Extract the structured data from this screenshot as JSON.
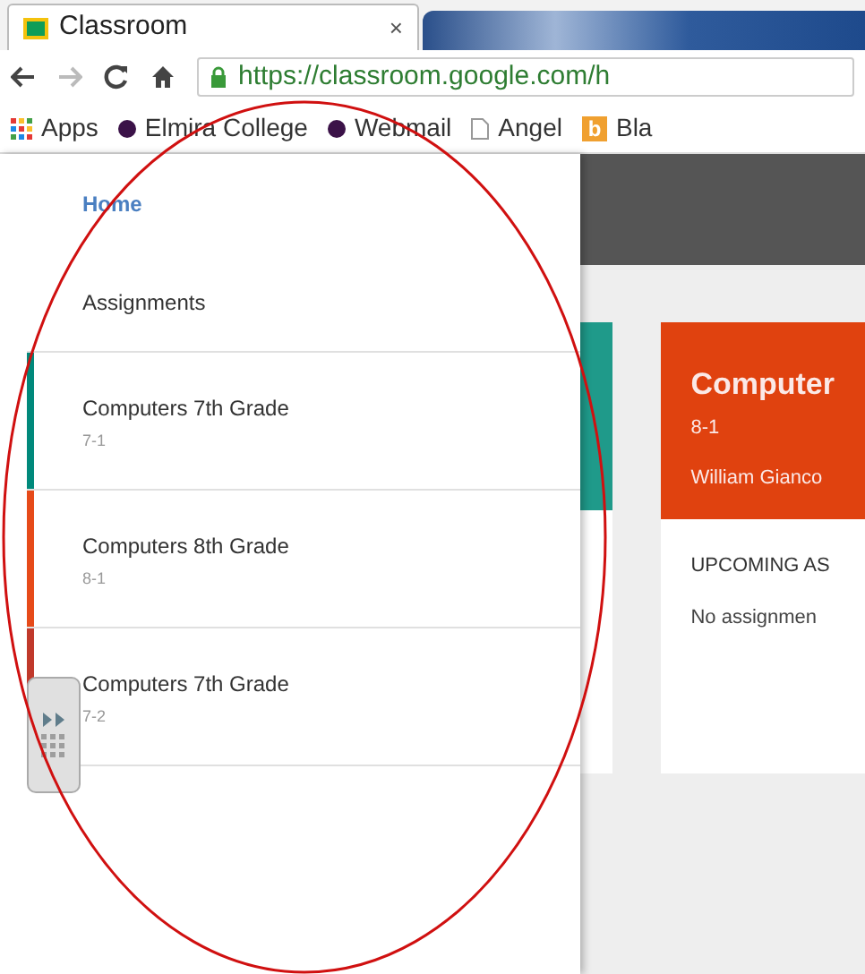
{
  "browser": {
    "tabs": [
      {
        "title": "Classroom",
        "close": "×",
        "selected": true
      },
      {
        "selected": false
      }
    ],
    "url": "https://classroom.google.com/h",
    "bookmarks": [
      {
        "label": "Apps",
        "kind": "apps"
      },
      {
        "label": "Elmira College",
        "kind": "dot"
      },
      {
        "label": "Webmail",
        "kind": "dot"
      },
      {
        "label": "Angel",
        "kind": "page"
      },
      {
        "label": "Bla",
        "kind": "letter",
        "icon_text": "b"
      }
    ]
  },
  "drawer": {
    "nav_items": [
      {
        "label": "Home",
        "selected": true
      },
      {
        "label": "Assignments",
        "selected": false
      }
    ],
    "classes": [
      {
        "name": "Computers 7th Grade",
        "section": "7-1",
        "color": "#00897b"
      },
      {
        "name": "Computers 8th Grade",
        "section": "8-1",
        "color": "#e64a19"
      },
      {
        "name": "Computers 7th Grade",
        "section": "7-2",
        "color": "#c0392b"
      }
    ]
  },
  "class_card": {
    "title": "Computer",
    "section": "8-1",
    "teacher": "William Gianco",
    "upcoming_heading": "UPCOMING AS",
    "upcoming_text": "No assignmen"
  }
}
